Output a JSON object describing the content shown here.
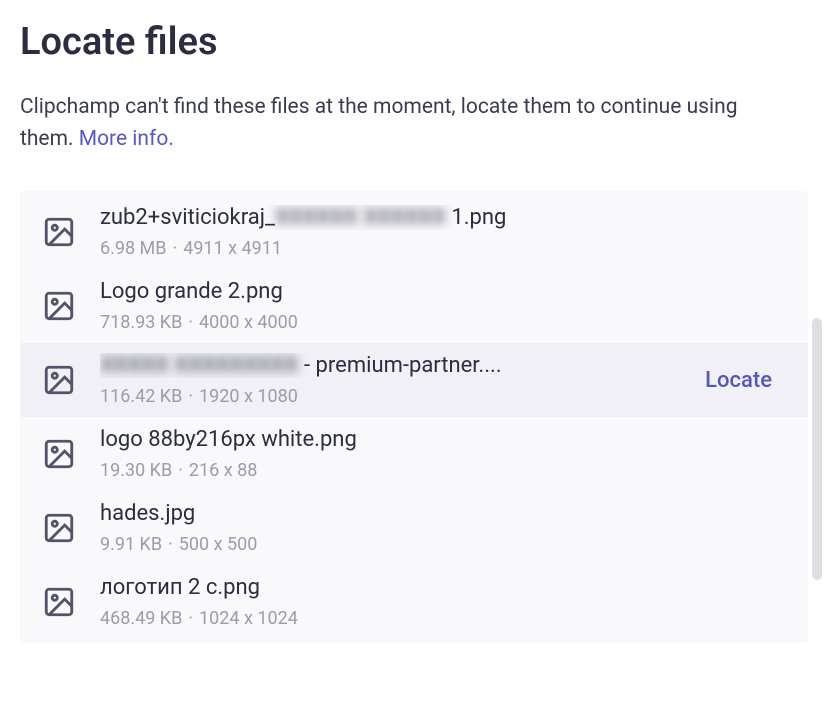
{
  "title": "Locate files",
  "description_pre": "Clipchamp can't find these files at the moment, locate them to continue using them. ",
  "more_info_label": "More info.",
  "locate_label": "Locate",
  "meta_separator": "·",
  "files": [
    {
      "name_pre": "zub2+sviticiokraj_",
      "name_blur": "XXXXXX XXXXXX",
      "name_post": " 1.png",
      "size": "6.98 MB",
      "dimensions": "4911 x 4911",
      "active": false,
      "show_locate": false
    },
    {
      "name_pre": "Logo grande 2.png",
      "name_blur": "",
      "name_post": "",
      "size": "718.93 KB",
      "dimensions": "4000 x 4000",
      "active": false,
      "show_locate": false
    },
    {
      "name_pre": "",
      "name_blur": "XXXXX XXXXXXXXX",
      "name_post": " - premium-partner....",
      "size": "116.42 KB",
      "dimensions": "1920 x 1080",
      "active": true,
      "show_locate": true
    },
    {
      "name_pre": "logo 88by216px white.png",
      "name_blur": "",
      "name_post": "",
      "size": "19.30 KB",
      "dimensions": "216 x 88",
      "active": false,
      "show_locate": false
    },
    {
      "name_pre": "hades.jpg",
      "name_blur": "",
      "name_post": "",
      "size": "9.91 KB",
      "dimensions": "500 x 500",
      "active": false,
      "show_locate": false
    },
    {
      "name_pre": "логотип 2 c.png",
      "name_blur": "",
      "name_post": "",
      "size": "468.49 KB",
      "dimensions": "1024 x 1024",
      "active": false,
      "show_locate": false
    }
  ]
}
